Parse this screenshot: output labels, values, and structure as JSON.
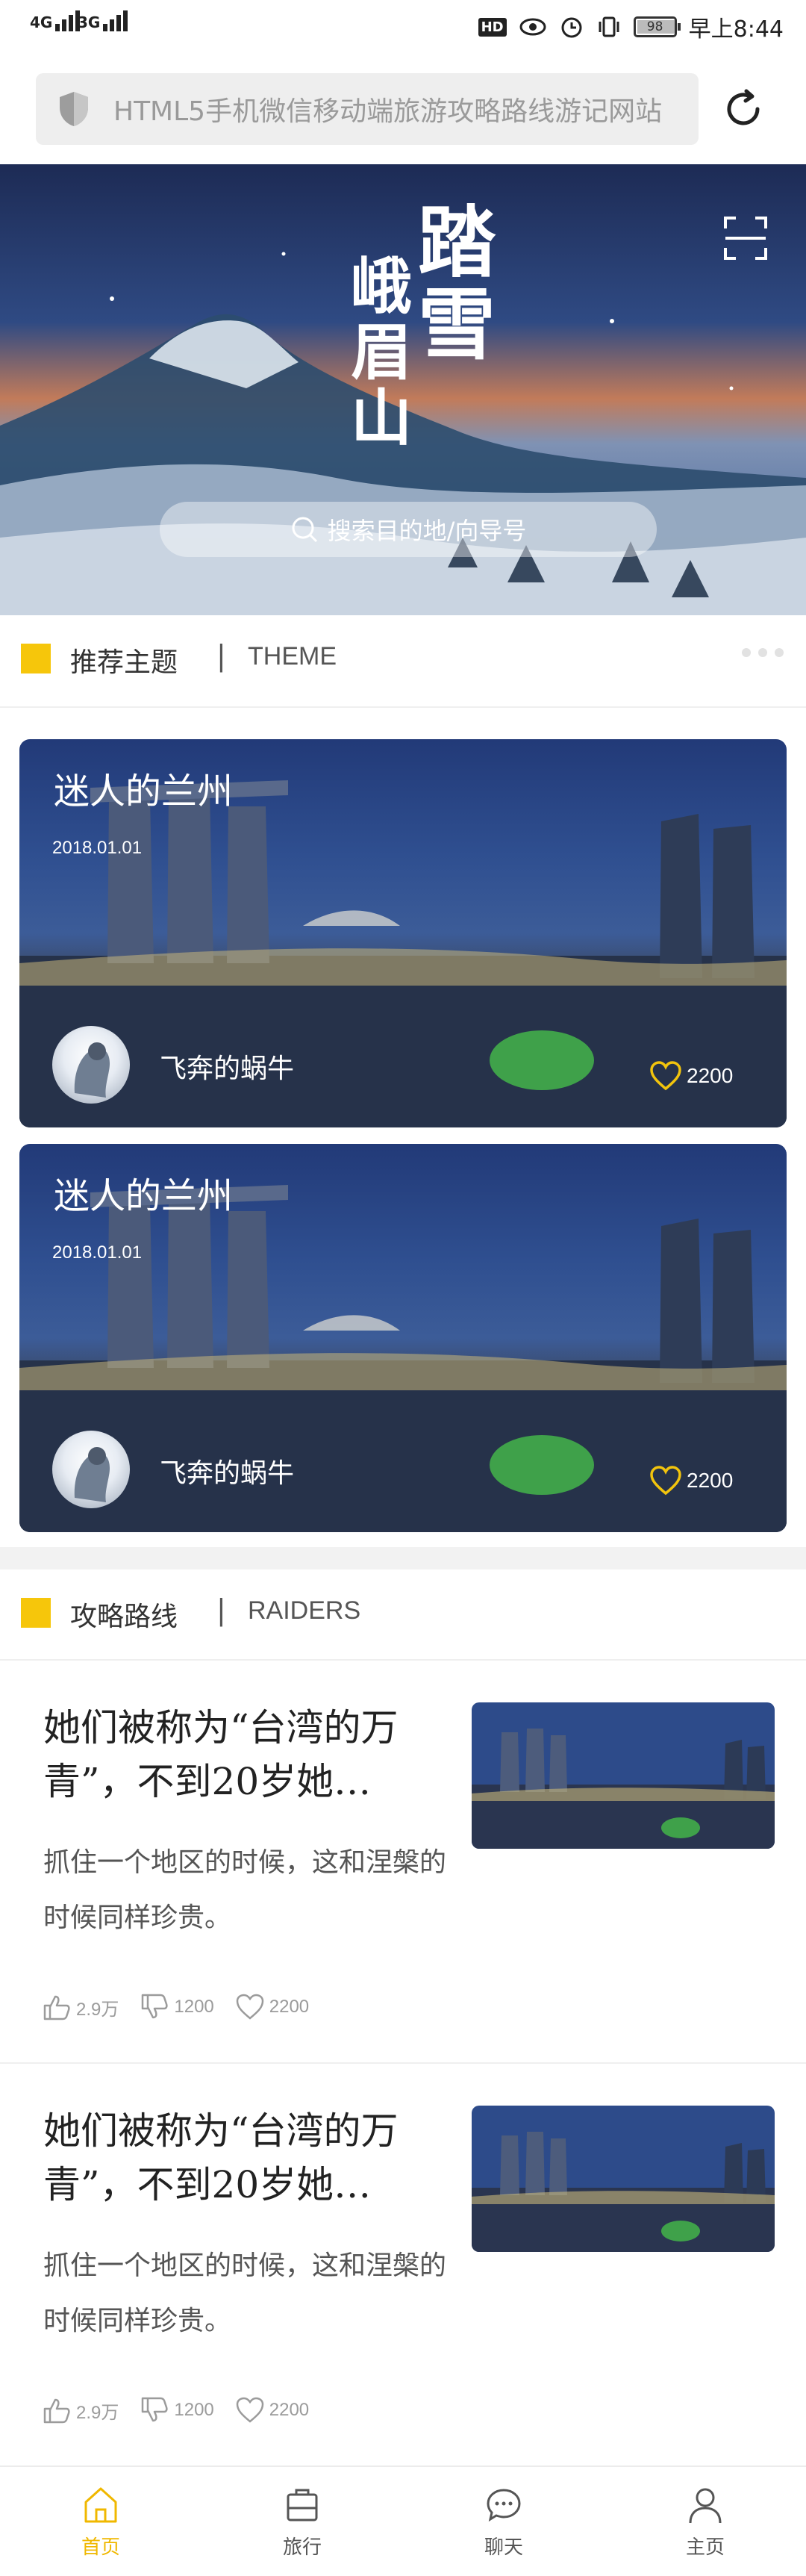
{
  "status_bar": {
    "network_1": "4G",
    "network_2": "3G",
    "hd": "HD",
    "battery": "98",
    "time": "早上8:44"
  },
  "url_bar": {
    "url_text": "HTML5手机微信移动端旅游攻略路线游记网站",
    "icons": [
      "shield-icon",
      "reload-icon"
    ]
  },
  "hero": {
    "title_main": "踏雪",
    "title_sub": "峨眉山",
    "search_placeholder": "搜索目的地/向导号",
    "icons": [
      "scan-icon",
      "search-icon"
    ]
  },
  "theme_section": {
    "title": "推荐主题",
    "separator": "|",
    "subtitle": "THEME",
    "cards": [
      {
        "title": "迷人的兰州",
        "date": "2018.01.01",
        "author": "飞奔的蜗牛",
        "likes": "2200"
      },
      {
        "title": "迷人的兰州",
        "date": "2018.01.01",
        "author": "飞奔的蜗牛",
        "likes": "2200"
      }
    ]
  },
  "raiders_section": {
    "title": "攻略路线",
    "separator": "|",
    "subtitle": "RAIDERS",
    "items": [
      {
        "title": "她们被称为“台湾的万青”，不到20岁她…",
        "desc": "抓住一个地区的时候，这和涅槃的时候同样珍贵。",
        "thumbs_up": "2.9万",
        "thumbs_down": "1200",
        "favorites": "2200"
      },
      {
        "title": "她们被称为“台湾的万青”，不到20岁她…",
        "desc": "抓住一个地区的时候，这和涅槃的时候同样珍贵。",
        "thumbs_up": "2.9万",
        "thumbs_down": "1200",
        "favorites": "2200"
      }
    ]
  },
  "bottom_nav": {
    "items": [
      {
        "label": "首页",
        "icon": "home-icon",
        "active": true
      },
      {
        "label": "旅行",
        "icon": "suitcase-icon",
        "active": false
      },
      {
        "label": "聊天",
        "icon": "chat-icon",
        "active": false
      },
      {
        "label": "主页",
        "icon": "user-icon",
        "active": false
      }
    ]
  },
  "colors": {
    "accent": "#f6c60b",
    "active_nav": "#f0b800",
    "text_muted": "#9b9b9b"
  }
}
